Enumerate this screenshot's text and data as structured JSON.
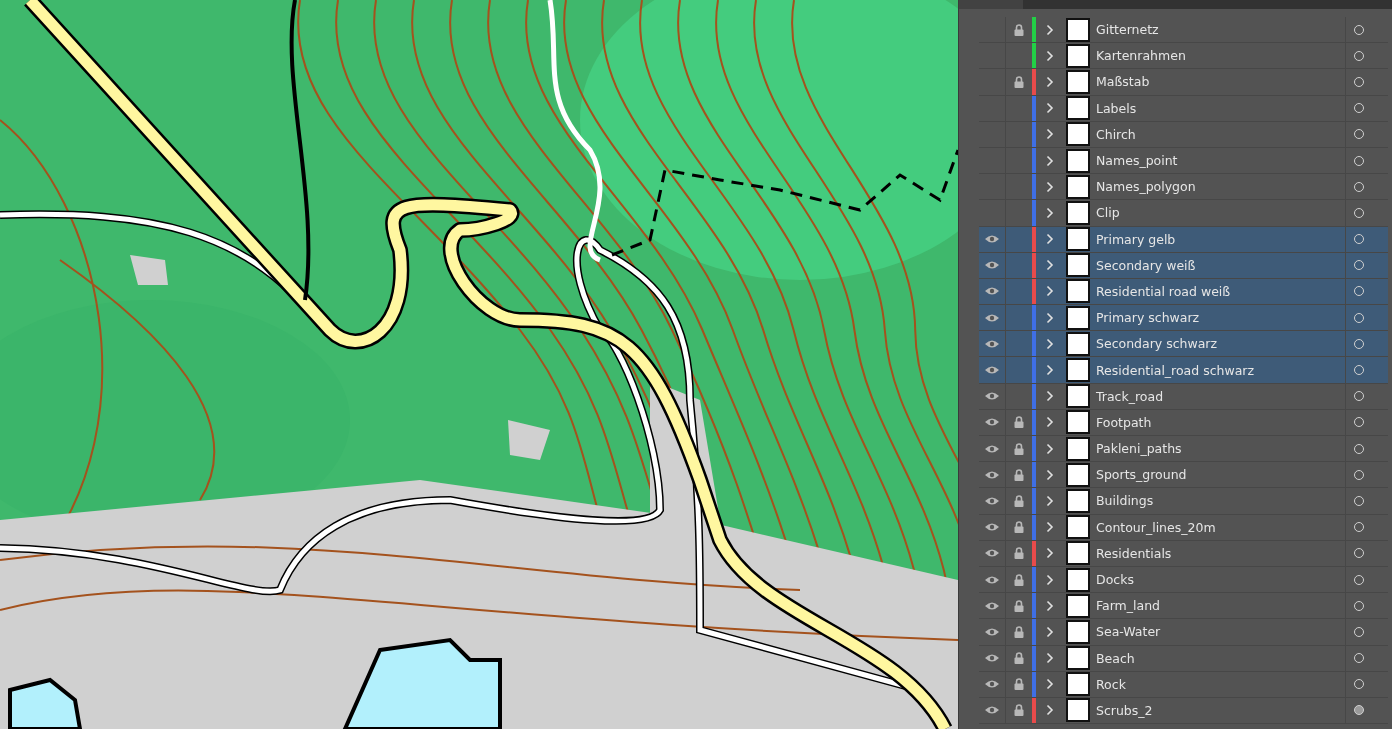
{
  "layers_panel": {
    "layers": [
      {
        "name": "Gitternetz",
        "visible": false,
        "locked": true,
        "color": "#22d046",
        "selected": false,
        "targeted": false
      },
      {
        "name": "Kartenrahmen",
        "visible": false,
        "locked": false,
        "color": "#22d046",
        "selected": false,
        "targeted": false
      },
      {
        "name": "Maßstab",
        "visible": false,
        "locked": true,
        "color": "#e84b4b",
        "selected": false,
        "targeted": false
      },
      {
        "name": "Labels",
        "visible": false,
        "locked": false,
        "color": "#3f6fe6",
        "selected": false,
        "targeted": false
      },
      {
        "name": "Chirch",
        "visible": false,
        "locked": false,
        "color": "#3f6fe6",
        "selected": false,
        "targeted": false
      },
      {
        "name": "Names_point",
        "visible": false,
        "locked": false,
        "color": "#3f6fe6",
        "selected": false,
        "targeted": false
      },
      {
        "name": "Names_polygon",
        "visible": false,
        "locked": false,
        "color": "#3f6fe6",
        "selected": false,
        "targeted": false
      },
      {
        "name": "Clip",
        "visible": false,
        "locked": false,
        "color": "#3f6fe6",
        "selected": false,
        "targeted": false
      },
      {
        "name": "Primary gelb",
        "visible": true,
        "locked": false,
        "color": "#e84b4b",
        "selected": true,
        "targeted": false
      },
      {
        "name": "Secondary weiß",
        "visible": true,
        "locked": false,
        "color": "#e84b4b",
        "selected": true,
        "targeted": false
      },
      {
        "name": "Residential road weiß",
        "visible": true,
        "locked": false,
        "color": "#e84b4b",
        "selected": true,
        "targeted": false
      },
      {
        "name": "Primary schwarz",
        "visible": true,
        "locked": false,
        "color": "#3f6fe6",
        "selected": true,
        "targeted": false
      },
      {
        "name": "Secondary schwarz",
        "visible": true,
        "locked": false,
        "color": "#3f6fe6",
        "selected": true,
        "targeted": false
      },
      {
        "name": "Residential_road schwarz",
        "visible": true,
        "locked": false,
        "color": "#3f6fe6",
        "selected": true,
        "targeted": false
      },
      {
        "name": "Track_road",
        "visible": true,
        "locked": false,
        "color": "#3f6fe6",
        "selected": false,
        "targeted": false
      },
      {
        "name": "Footpath",
        "visible": true,
        "locked": true,
        "color": "#3f6fe6",
        "selected": false,
        "targeted": false
      },
      {
        "name": "Pakleni_paths",
        "visible": true,
        "locked": true,
        "color": "#3f6fe6",
        "selected": false,
        "targeted": false
      },
      {
        "name": "Sports_ground",
        "visible": true,
        "locked": true,
        "color": "#3f6fe6",
        "selected": false,
        "targeted": false
      },
      {
        "name": "Buildings",
        "visible": true,
        "locked": true,
        "color": "#3f6fe6",
        "selected": false,
        "targeted": false
      },
      {
        "name": "Contour_lines_20m",
        "visible": true,
        "locked": true,
        "color": "#3f6fe6",
        "selected": false,
        "targeted": false
      },
      {
        "name": "Residentials",
        "visible": true,
        "locked": true,
        "color": "#e84b4b",
        "selected": false,
        "targeted": false
      },
      {
        "name": "Docks",
        "visible": true,
        "locked": true,
        "color": "#3f6fe6",
        "selected": false,
        "targeted": false
      },
      {
        "name": "Farm_land",
        "visible": true,
        "locked": true,
        "color": "#3f6fe6",
        "selected": false,
        "targeted": false
      },
      {
        "name": "Sea-Water",
        "visible": true,
        "locked": true,
        "color": "#3f6fe6",
        "selected": false,
        "targeted": false
      },
      {
        "name": "Beach",
        "visible": true,
        "locked": true,
        "color": "#3f6fe6",
        "selected": false,
        "targeted": false
      },
      {
        "name": "Rock",
        "visible": true,
        "locked": true,
        "color": "#3f6fe6",
        "selected": false,
        "targeted": false
      },
      {
        "name": "Scrubs_2",
        "visible": true,
        "locked": true,
        "color": "#e84b4b",
        "selected": false,
        "targeted": true
      }
    ]
  }
}
